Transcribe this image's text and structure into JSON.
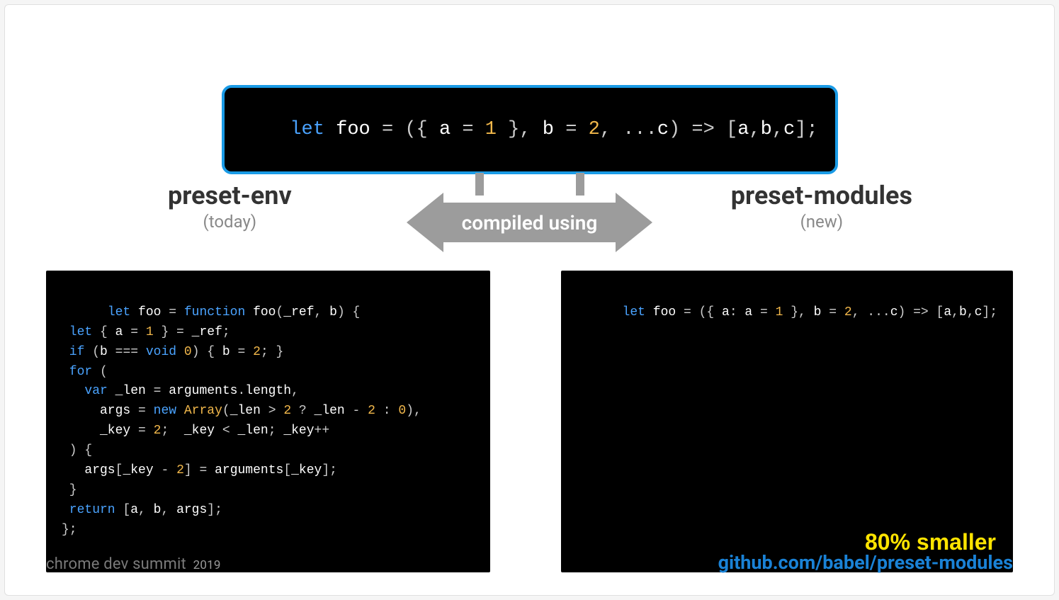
{
  "topCode": {
    "tokens": [
      {
        "t": "let ",
        "c": "kw"
      },
      {
        "t": "foo ",
        "c": "id"
      },
      {
        "t": "= ({ ",
        "c": "pn"
      },
      {
        "t": "a ",
        "c": "id"
      },
      {
        "t": "= ",
        "c": "pn"
      },
      {
        "t": "1 ",
        "c": "num"
      },
      {
        "t": "}, ",
        "c": "pn"
      },
      {
        "t": "b ",
        "c": "id"
      },
      {
        "t": "= ",
        "c": "pn"
      },
      {
        "t": "2",
        "c": "num"
      },
      {
        "t": ", ...",
        "c": "pn"
      },
      {
        "t": "c",
        "c": "id"
      },
      {
        "t": ") => [",
        "c": "pn"
      },
      {
        "t": "a",
        "c": "id"
      },
      {
        "t": ",",
        "c": "pn"
      },
      {
        "t": "b",
        "c": "id"
      },
      {
        "t": ",",
        "c": "pn"
      },
      {
        "t": "c",
        "c": "id"
      },
      {
        "t": "];",
        "c": "pn"
      }
    ]
  },
  "arrowLabel": "compiled using",
  "left": {
    "title": "preset-env",
    "subtitle": "(today)",
    "code": {
      "tokens": [
        {
          "t": "let ",
          "c": "kw"
        },
        {
          "t": "foo ",
          "c": "id"
        },
        {
          "t": "= ",
          "c": "pn"
        },
        {
          "t": "function ",
          "c": "kw"
        },
        {
          "t": "foo",
          "c": "id"
        },
        {
          "t": "(",
          "c": "pn"
        },
        {
          "t": "_ref",
          "c": "id"
        },
        {
          "t": ", ",
          "c": "pn"
        },
        {
          "t": "b",
          "c": "id"
        },
        {
          "t": ") {\n",
          "c": "pn"
        },
        {
          "t": " let ",
          "c": "kw"
        },
        {
          "t": "{ ",
          "c": "pn"
        },
        {
          "t": "a ",
          "c": "id"
        },
        {
          "t": "= ",
          "c": "pn"
        },
        {
          "t": "1 ",
          "c": "num"
        },
        {
          "t": "} = ",
          "c": "pn"
        },
        {
          "t": "_ref",
          "c": "id"
        },
        {
          "t": ";\n",
          "c": "pn"
        },
        {
          "t": " if ",
          "c": "kw"
        },
        {
          "t": "(",
          "c": "pn"
        },
        {
          "t": "b ",
          "c": "id"
        },
        {
          "t": "=== ",
          "c": "pn"
        },
        {
          "t": "void ",
          "c": "kw"
        },
        {
          "t": "0",
          "c": "num"
        },
        {
          "t": ") { ",
          "c": "pn"
        },
        {
          "t": "b ",
          "c": "id"
        },
        {
          "t": "= ",
          "c": "pn"
        },
        {
          "t": "2",
          "c": "num"
        },
        {
          "t": "; }\n",
          "c": "pn"
        },
        {
          "t": " for ",
          "c": "kw"
        },
        {
          "t": "(\n",
          "c": "pn"
        },
        {
          "t": "   var ",
          "c": "kw"
        },
        {
          "t": "_len ",
          "c": "id"
        },
        {
          "t": "= ",
          "c": "pn"
        },
        {
          "t": "arguments",
          "c": "id"
        },
        {
          "t": ".",
          "c": "pn"
        },
        {
          "t": "length",
          "c": "id"
        },
        {
          "t": ",\n",
          "c": "pn"
        },
        {
          "t": "     args ",
          "c": "id"
        },
        {
          "t": "= ",
          "c": "pn"
        },
        {
          "t": "new ",
          "c": "kw"
        },
        {
          "t": "Array",
          "c": "fn"
        },
        {
          "t": "(",
          "c": "pn"
        },
        {
          "t": "_len ",
          "c": "id"
        },
        {
          "t": "> ",
          "c": "pn"
        },
        {
          "t": "2 ",
          "c": "num"
        },
        {
          "t": "? ",
          "c": "pn"
        },
        {
          "t": "_len ",
          "c": "id"
        },
        {
          "t": "- ",
          "c": "pn"
        },
        {
          "t": "2 ",
          "c": "num"
        },
        {
          "t": ": ",
          "c": "pn"
        },
        {
          "t": "0",
          "c": "num"
        },
        {
          "t": "),\n",
          "c": "pn"
        },
        {
          "t": "     _key ",
          "c": "id"
        },
        {
          "t": "= ",
          "c": "pn"
        },
        {
          "t": "2",
          "c": "num"
        },
        {
          "t": ";  ",
          "c": "pn"
        },
        {
          "t": "_key ",
          "c": "id"
        },
        {
          "t": "< ",
          "c": "pn"
        },
        {
          "t": "_len",
          "c": "id"
        },
        {
          "t": "; ",
          "c": "pn"
        },
        {
          "t": "_key",
          "c": "id"
        },
        {
          "t": "++\n",
          "c": "pn"
        },
        {
          "t": " ) {\n",
          "c": "pn"
        },
        {
          "t": "   args",
          "c": "id"
        },
        {
          "t": "[",
          "c": "pn"
        },
        {
          "t": "_key ",
          "c": "id"
        },
        {
          "t": "- ",
          "c": "pn"
        },
        {
          "t": "2",
          "c": "num"
        },
        {
          "t": "] = ",
          "c": "pn"
        },
        {
          "t": "arguments",
          "c": "id"
        },
        {
          "t": "[",
          "c": "pn"
        },
        {
          "t": "_key",
          "c": "id"
        },
        {
          "t": "];\n",
          "c": "pn"
        },
        {
          "t": " }\n",
          "c": "pn"
        },
        {
          "t": " return ",
          "c": "kw"
        },
        {
          "t": "[",
          "c": "pn"
        },
        {
          "t": "a",
          "c": "id"
        },
        {
          "t": ", ",
          "c": "pn"
        },
        {
          "t": "b",
          "c": "id"
        },
        {
          "t": ", ",
          "c": "pn"
        },
        {
          "t": "args",
          "c": "id"
        },
        {
          "t": "];\n",
          "c": "pn"
        },
        {
          "t": "};",
          "c": "pn"
        }
      ]
    }
  },
  "right": {
    "title": "preset-modules",
    "subtitle": "(new)",
    "code": {
      "tokens": [
        {
          "t": "let ",
          "c": "kw"
        },
        {
          "t": "foo ",
          "c": "id"
        },
        {
          "t": "= ({ ",
          "c": "pn"
        },
        {
          "t": "a",
          "c": "id"
        },
        {
          "t": ": ",
          "c": "pn"
        },
        {
          "t": "a ",
          "c": "id"
        },
        {
          "t": "= ",
          "c": "pn"
        },
        {
          "t": "1 ",
          "c": "num"
        },
        {
          "t": "}, ",
          "c": "pn"
        },
        {
          "t": "b ",
          "c": "id"
        },
        {
          "t": "= ",
          "c": "pn"
        },
        {
          "t": "2",
          "c": "num"
        },
        {
          "t": ", ...",
          "c": "pn"
        },
        {
          "t": "c",
          "c": "id"
        },
        {
          "t": ") => [",
          "c": "pn"
        },
        {
          "t": "a",
          "c": "id"
        },
        {
          "t": ",",
          "c": "pn"
        },
        {
          "t": "b",
          "c": "id"
        },
        {
          "t": ",",
          "c": "pn"
        },
        {
          "t": "c",
          "c": "id"
        },
        {
          "t": "];",
          "c": "pn"
        }
      ]
    },
    "badge": "80% smaller"
  },
  "footer": {
    "event": "chrome dev summit",
    "year": "2019",
    "link": "github.com/babel/preset-modules"
  }
}
